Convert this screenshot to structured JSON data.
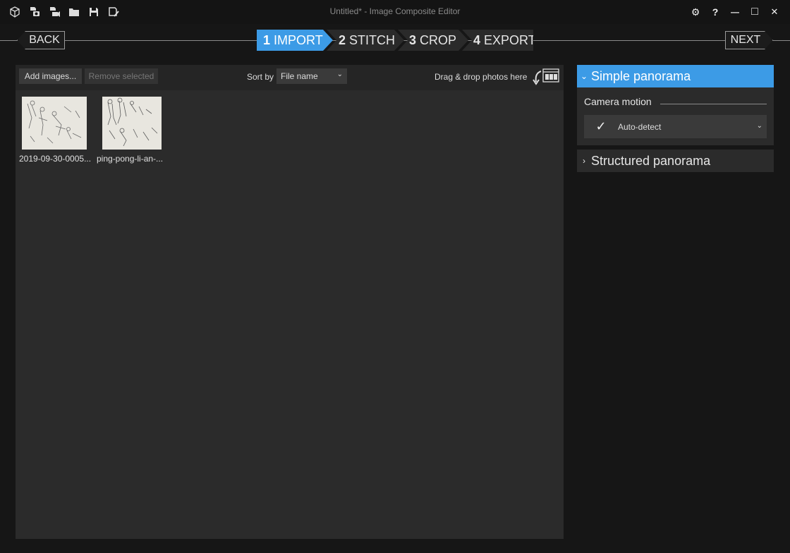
{
  "window": {
    "title": "Untitled* - Image Composite Editor",
    "toolbar_icons": [
      "new-project-icon",
      "new-panorama-from-images-icon",
      "new-panorama-from-video-icon",
      "open-icon",
      "save-icon",
      "save-as-icon"
    ],
    "controls": {
      "settings": "⚙",
      "help": "?",
      "minimize": "—",
      "maximize": "□",
      "close": "✕"
    }
  },
  "wizard": {
    "back_label": "BACK",
    "next_label": "NEXT",
    "steps": [
      {
        "num": "1",
        "label": "IMPORT",
        "active": true
      },
      {
        "num": "2",
        "label": "STITCH",
        "active": false
      },
      {
        "num": "3",
        "label": "CROP",
        "active": false
      },
      {
        "num": "4",
        "label": "EXPORT",
        "active": false
      }
    ]
  },
  "import_toolbar": {
    "add_images": "Add images...",
    "remove_selected": "Remove selected",
    "sort_by_label": "Sort by",
    "sort_value": "File name",
    "drop_hint": "Drag & drop photos here"
  },
  "images": [
    {
      "caption": "2019-09-30-0005..."
    },
    {
      "caption": "ping-pong-li-an-..."
    }
  ],
  "panel": {
    "simple_panorama": "Simple panorama",
    "camera_motion_label": "Camera motion",
    "camera_motion_value": "Auto-detect",
    "structured_panorama": "Structured panorama"
  },
  "colors": {
    "accent": "#3c9be6",
    "background": "#161616",
    "pane": "#2b2b2b"
  }
}
